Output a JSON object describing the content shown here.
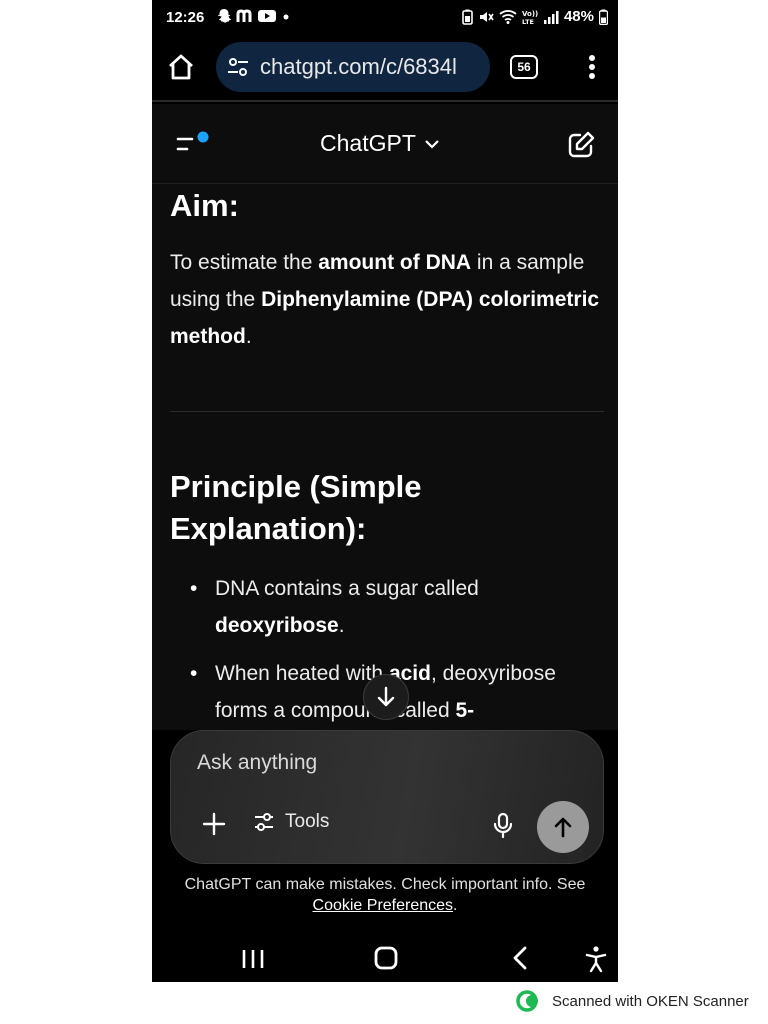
{
  "status_bar": {
    "time": "12:26",
    "battery": "48%",
    "left_icons": [
      "snapchat-icon",
      "m-icon",
      "youtube-icon",
      "dot-icon"
    ],
    "right_icons": [
      "battery-saver-icon",
      "mute-icon",
      "wifi-icon",
      "volte-icon",
      "signal-icon",
      "battery-icon"
    ]
  },
  "browser": {
    "url": "chatgpt.com/c/6834l",
    "tab_count": "56"
  },
  "header": {
    "model_name": "ChatGPT",
    "sidebar_badge_color": "#1aa3ff"
  },
  "content": {
    "aim_heading": "Aim:",
    "aim_text": {
      "t1": "To estimate the ",
      "b1": "amount of DNA",
      "t2": " in a sample using the ",
      "b2": "Diphenylamine (DPA) colorimetric method",
      "t3": "."
    },
    "principle_heading": "Principle (Simple Explanation):",
    "bullets": [
      {
        "text": "DNA contains a sugar called ",
        "bold": "deoxyribose",
        "after": "."
      },
      {
        "text": "When heated with ",
        "bold": "acid",
        "after": ", deoxyribose forms a compound called ",
        "bold2": "5-"
      }
    ]
  },
  "composer": {
    "placeholder": "Ask anything",
    "tools_label": "Tools"
  },
  "disclaimer": {
    "text": "ChatGPT can make mistakes. Check important info. See",
    "link": "Cookie Preferences",
    "end": "."
  },
  "footer": {
    "scanner_text": "Scanned with OKEN Scanner"
  }
}
